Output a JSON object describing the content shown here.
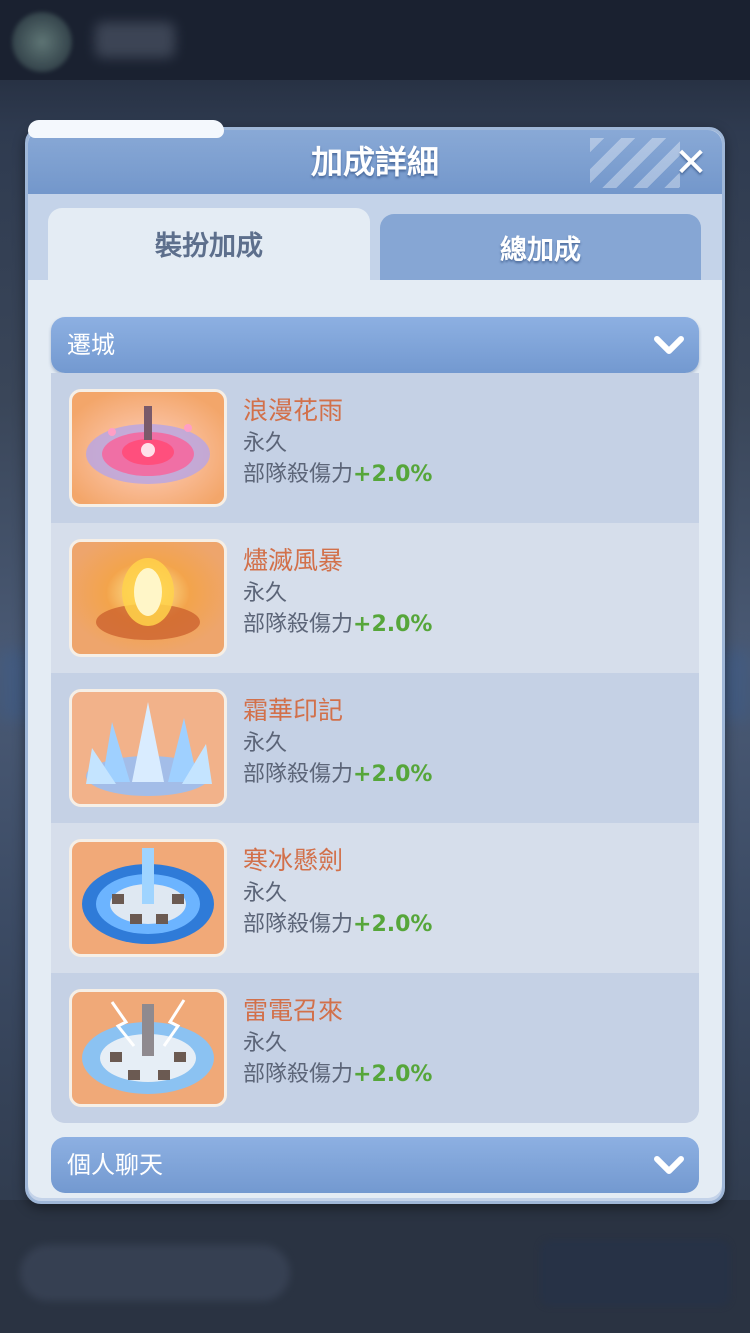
{
  "dialog": {
    "title": "加成詳細",
    "tabs": [
      {
        "label": "裝扮加成",
        "active": true
      },
      {
        "label": "總加成",
        "active": false
      }
    ]
  },
  "sections": [
    {
      "label": "遷城",
      "expanded": true,
      "items": [
        {
          "name": "浪漫花雨",
          "duration": "永久",
          "effect_label": "部隊殺傷力",
          "effect_value": "+2.0%"
        },
        {
          "name": "燼滅風暴",
          "duration": "永久",
          "effect_label": "部隊殺傷力",
          "effect_value": "+2.0%"
        },
        {
          "name": "霜華印記",
          "duration": "永久",
          "effect_label": "部隊殺傷力",
          "effect_value": "+2.0%"
        },
        {
          "name": "寒冰懸劍",
          "duration": "永久",
          "effect_label": "部隊殺傷力",
          "effect_value": "+2.0%"
        },
        {
          "name": "雷電召來",
          "duration": "永久",
          "effect_label": "部隊殺傷力",
          "effect_value": "+2.0%"
        }
      ]
    },
    {
      "label": "個人聊天",
      "expanded": false
    }
  ],
  "colors": {
    "item_name": "#d2704a",
    "effect_value": "#56a63a",
    "header_blue": "#7399d0"
  },
  "icons": [
    "close-icon",
    "chevron-down-icon"
  ]
}
